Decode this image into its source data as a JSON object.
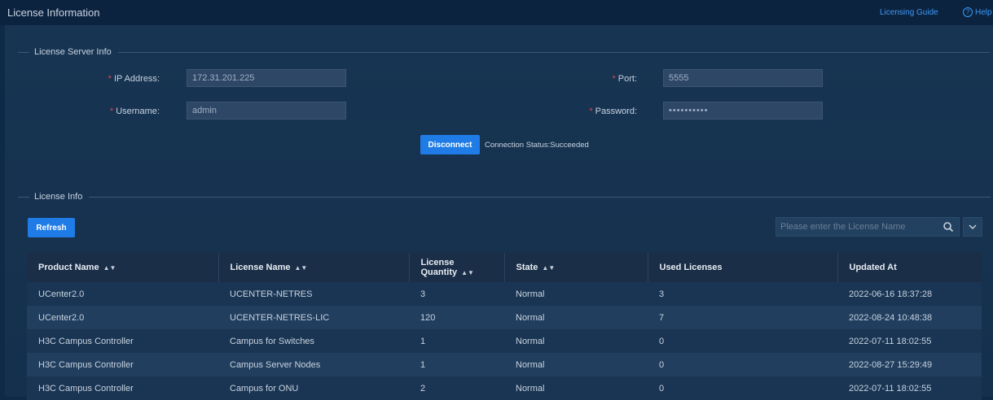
{
  "header": {
    "title": "License Information",
    "guide_label": "Licensing Guide",
    "help_label": "Help"
  },
  "server_info": {
    "section_title": "License Server Info",
    "ip_label": "IP Address",
    "ip_value": "172.31.201.225",
    "port_label": "Port",
    "port_value": "5555",
    "username_label": "Username",
    "username_value": "admin",
    "password_label": "Password",
    "password_value": "••••••••••",
    "disconnect_label": "Disconnect",
    "connection_status": "Connection Status:Succeeded"
  },
  "license_info": {
    "section_title": "License Info",
    "refresh_label": "Refresh",
    "search_placeholder": "Please enter the License Name"
  },
  "table": {
    "columns": [
      "Product Name",
      "License Name",
      "License Quantity",
      "State",
      "Used Licenses",
      "Updated At"
    ],
    "rows": [
      [
        "UCenter2.0",
        "UCENTER-NETRES",
        "3",
        "Normal",
        "3",
        "2022-06-16 18:37:28"
      ],
      [
        "UCenter2.0",
        "UCENTER-NETRES-LIC",
        "120",
        "Normal",
        "7",
        "2022-08-24 10:48:38"
      ],
      [
        "H3C Campus Controller",
        "Campus for Switches",
        "1",
        "Normal",
        "0",
        "2022-07-11 18:02:55"
      ],
      [
        "H3C Campus Controller",
        "Campus Server Nodes",
        "1",
        "Normal",
        "0",
        "2022-08-27 15:29:49"
      ],
      [
        "H3C Campus Controller",
        "Campus for ONU",
        "2",
        "Normal",
        "0",
        "2022-07-11 18:02:55"
      ]
    ]
  },
  "colors": {
    "accent": "#1f7ce6",
    "link": "#3d9af5",
    "required": "#e2434f",
    "background": "#0f2a47"
  }
}
